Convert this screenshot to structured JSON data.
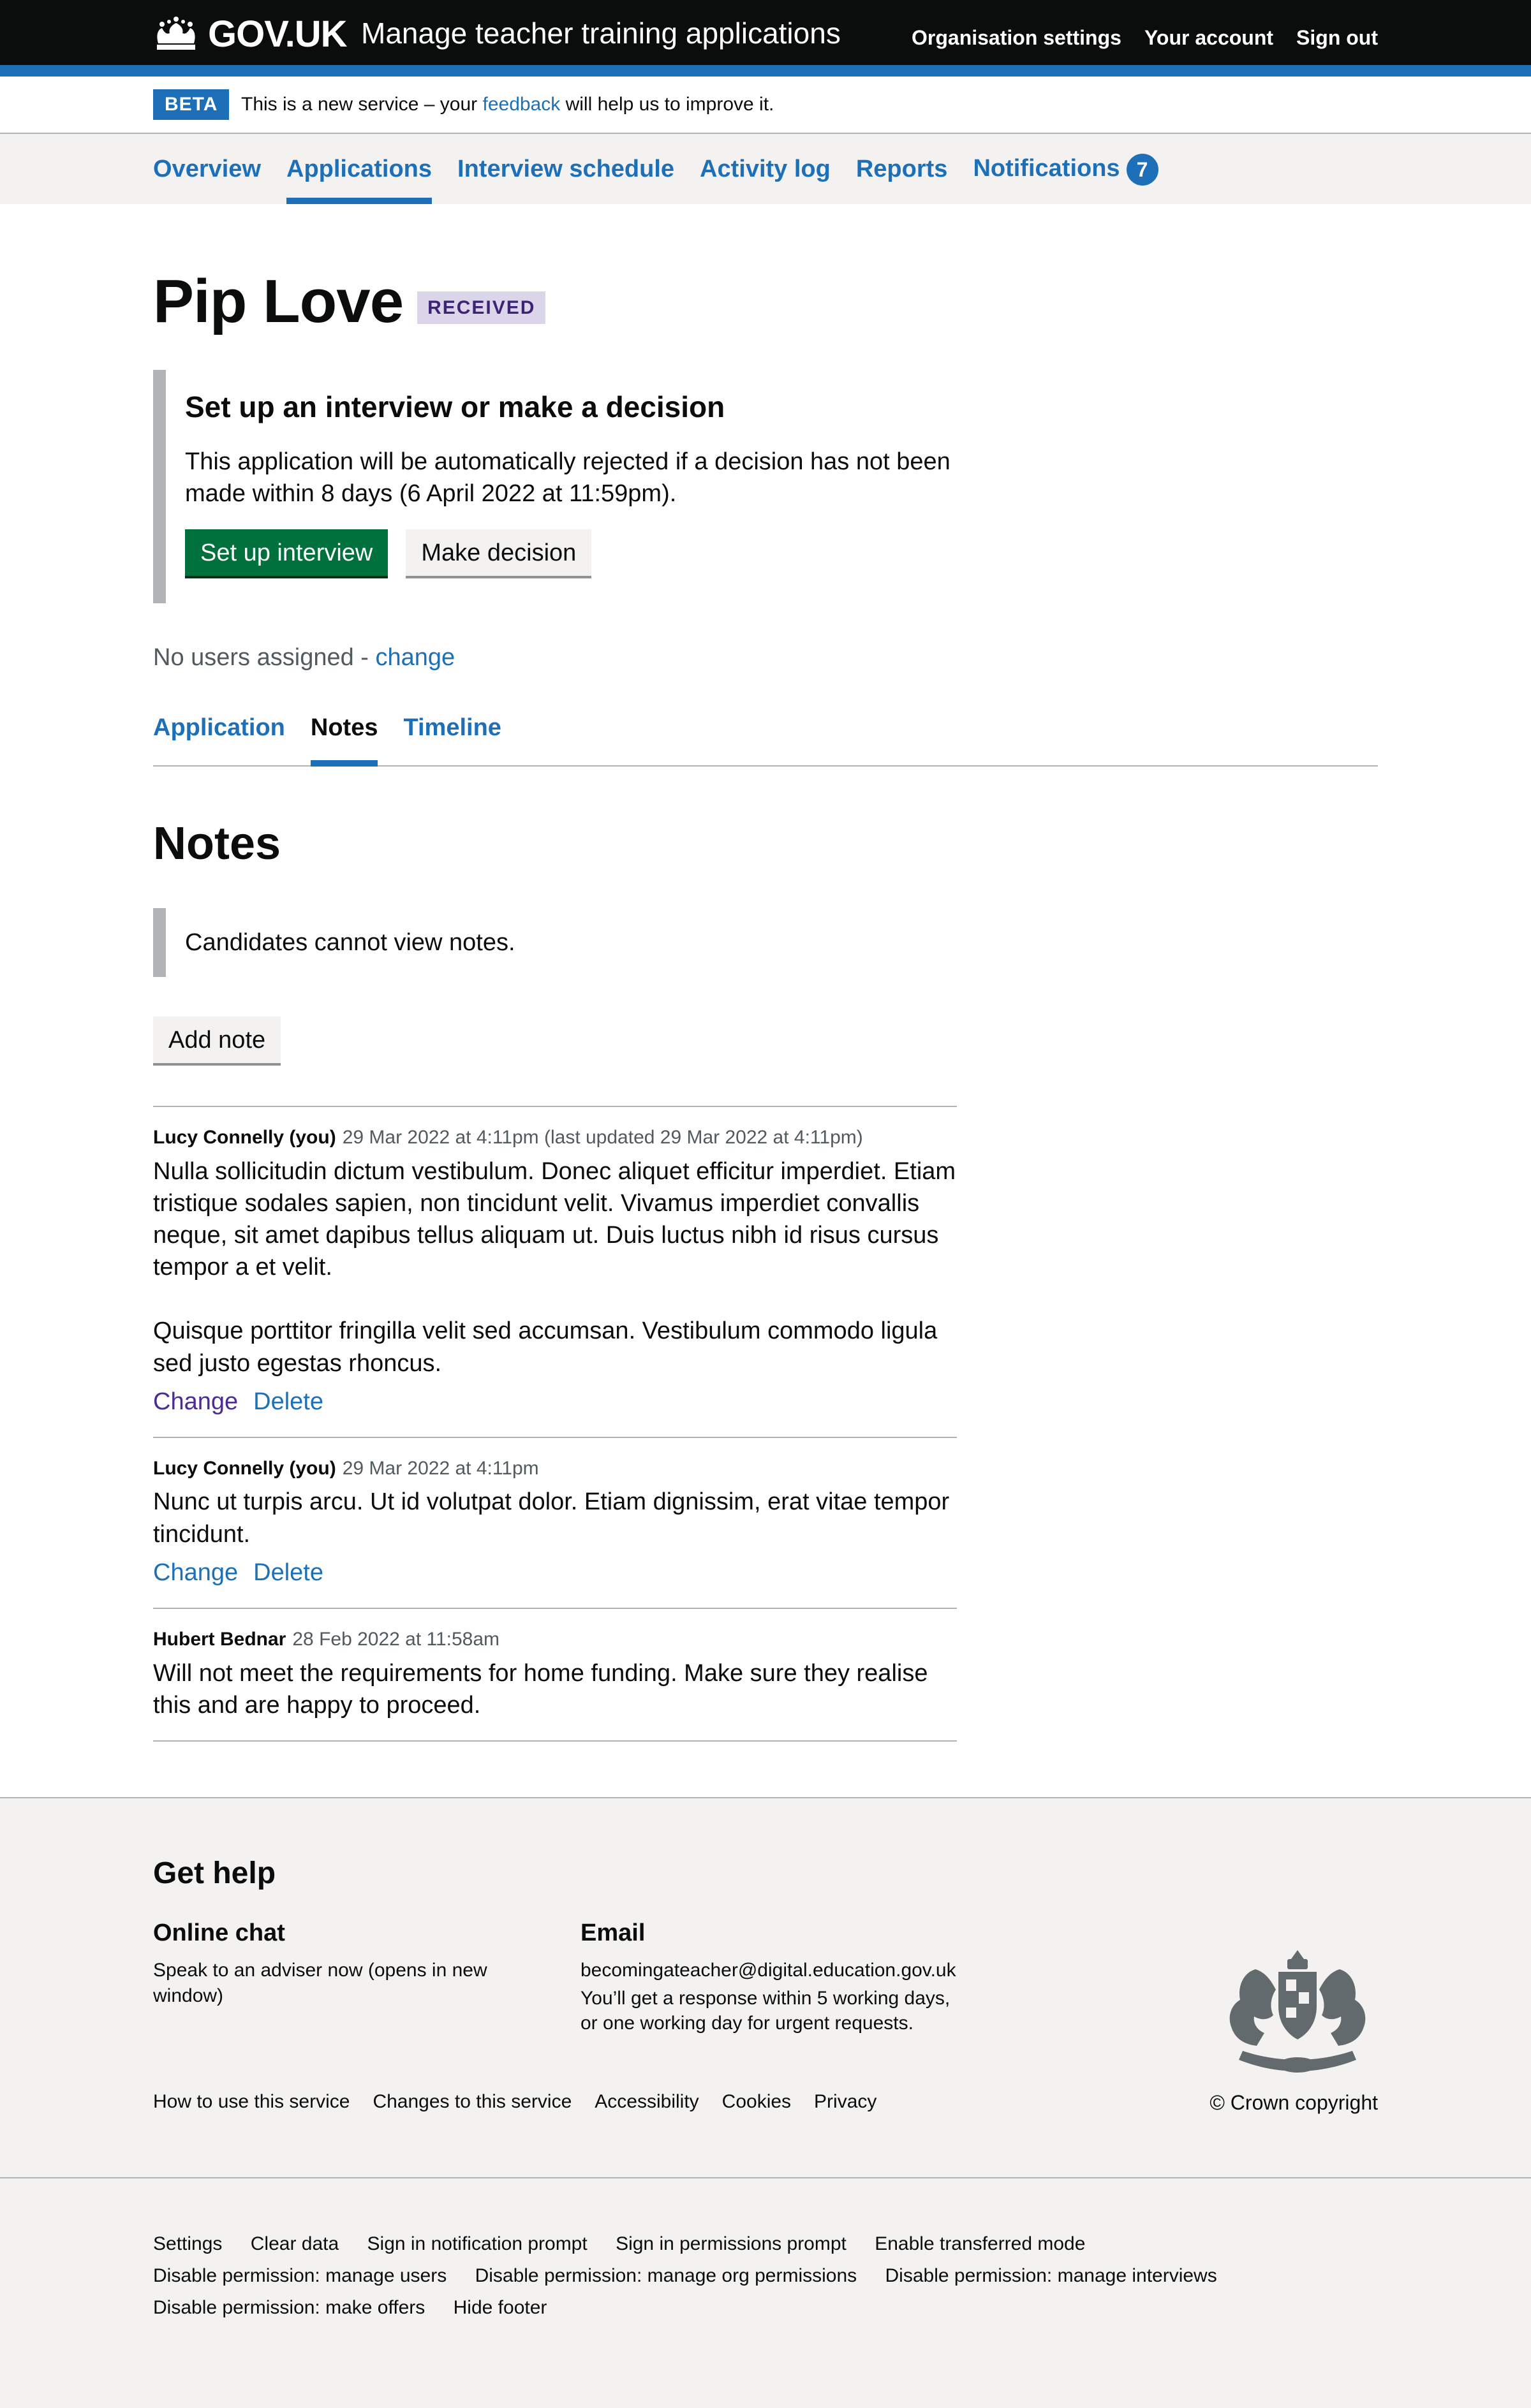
{
  "header": {
    "logo_text": "GOV.UK",
    "service_name": "Manage teacher training applications",
    "nav": [
      "Organisation settings",
      "Your account",
      "Sign out"
    ]
  },
  "phase_banner": {
    "tag": "BETA",
    "text_before": "This is a new service – your",
    "link": "feedback",
    "text_after": "will help us to improve it."
  },
  "primary_nav": {
    "items": [
      "Overview",
      "Applications",
      "Interview schedule",
      "Activity log",
      "Reports",
      "Notifications"
    ],
    "active": "Applications",
    "notifications_count": "7"
  },
  "page": {
    "title": "Pip Love",
    "status": "RECEIVED"
  },
  "decision_inset": {
    "heading": "Set up an interview or make a decision",
    "text": "This application will be automatically rejected if a decision has not been made within 8 days (6 April 2022 at 11:59pm).",
    "primary_button": "Set up interview",
    "secondary_button": "Make decision"
  },
  "assignment": {
    "text": "No users assigned -",
    "link": "change"
  },
  "sub_nav": {
    "items": [
      "Application",
      "Notes",
      "Timeline"
    ],
    "active": "Notes"
  },
  "notes_section": {
    "heading": "Notes",
    "info": "Candidates cannot view notes.",
    "add_button": "Add note",
    "notes": [
      {
        "author": "Lucy Connelly (you)",
        "date": "29 Mar 2022 at 4:11pm (last updated 29 Mar 2022 at 4:11pm)",
        "body": "Nulla sollicitudin dictum vestibulum. Donec aliquet efficitur imperdiet. Etiam tristique sodales sapien, non tincidunt velit. Vivamus imperdiet convallis neque, sit amet dapibus tellus aliquam ut. Duis luctus nibh id risus cursus tempor a et velit.\n\nQuisque porttitor fringilla velit sed accumsan. Vestibulum commodo ligula sed justo egestas rhoncus.",
        "actions": [
          "Change",
          "Delete"
        ]
      },
      {
        "author": "Lucy Connelly (you)",
        "date": "29 Mar 2022 at 4:11pm",
        "body": "Nunc ut turpis arcu. Ut id volutpat dolor. Etiam dignissim, erat vitae tempor tincidunt.",
        "actions": [
          "Change",
          "Delete"
        ]
      },
      {
        "author": "Hubert Bednar",
        "date": "28 Feb 2022 at 11:58am",
        "body": "Will not meet the requirements for home funding. Make sure they realise this and are happy to proceed.",
        "actions": []
      }
    ]
  },
  "footer": {
    "heading": "Get help",
    "online_chat": {
      "heading": "Online chat",
      "link": "Speak to an adviser now (opens in new window)"
    },
    "email": {
      "heading": "Email",
      "link": "becomingateacher@digital.education.gov.uk",
      "note_line1": "You’ll get a response within 5 working days,",
      "note_line2": "or one working day for urgent requests."
    },
    "links": [
      "How to use this service",
      "Changes to this service",
      "Accessibility",
      "Cookies",
      "Privacy"
    ],
    "copyright": "© Crown copyright",
    "dev_links": [
      "Settings",
      "Clear data",
      "Sign in notification prompt",
      "Sign in permissions prompt",
      "Enable transferred mode",
      "Disable permission: manage users",
      "Disable permission: manage org permissions",
      "Disable permission: manage interviews",
      "Disable permission: make offers",
      "Hide footer"
    ]
  },
  "colors": {
    "header_bg": "#0b0c0c",
    "brand_blue": "#1d70b8",
    "primary_button": "#00703c",
    "status_tag_bg": "#dbd5e9",
    "status_tag_text": "#3d2375",
    "footer_bg": "#f3f2f1"
  }
}
